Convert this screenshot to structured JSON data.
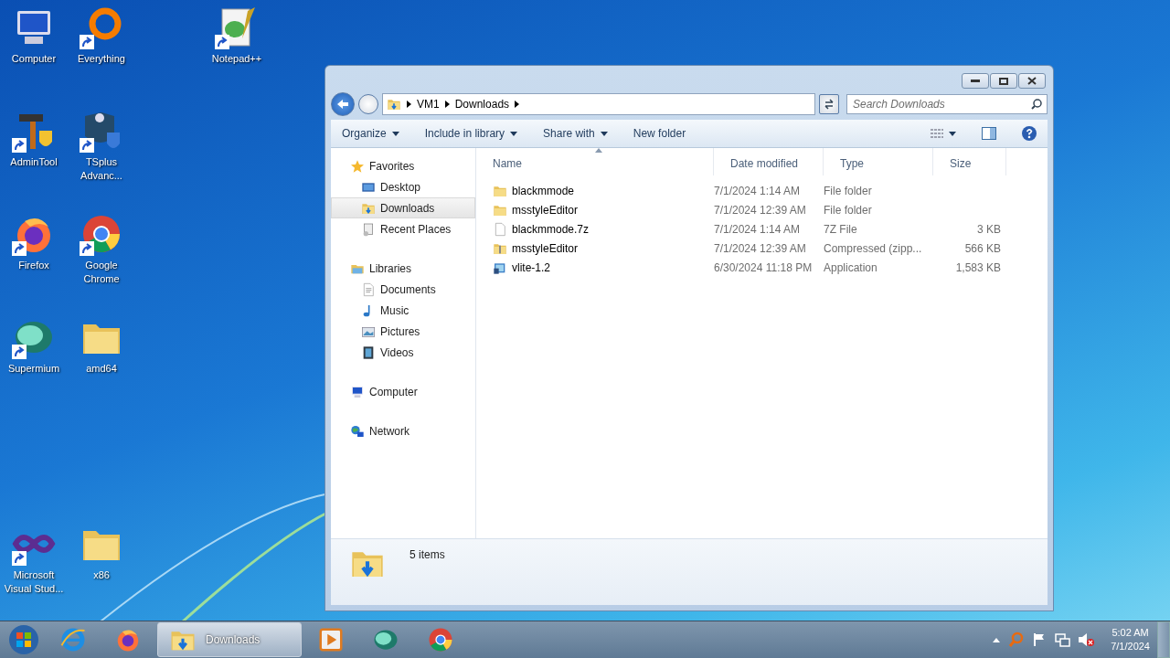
{
  "desktop_icons": [
    {
      "label": "Computer",
      "kind": "computer",
      "shortcut": false
    },
    {
      "label": "Everything",
      "kind": "ring",
      "shortcut": true
    },
    {
      "label": "Notepad++",
      "kind": "notepad",
      "shortcut": true
    },
    {
      "label": "AdminTool",
      "kind": "hammer",
      "shortcut": true
    },
    {
      "label": "TSplus Advanc...",
      "kind": "shield",
      "shortcut": true
    },
    {
      "label": "Firefox",
      "kind": "firefox",
      "shortcut": true
    },
    {
      "label": "Google Chrome",
      "kind": "chrome",
      "shortcut": true
    },
    {
      "label": "Supermium",
      "kind": "supermium",
      "shortcut": true
    },
    {
      "label": "amd64",
      "kind": "folder",
      "shortcut": false
    },
    {
      "label": "Microsoft Visual Stud...",
      "kind": "vs",
      "shortcut": true
    },
    {
      "label": "x86",
      "kind": "folder",
      "shortcut": false
    }
  ],
  "explorer": {
    "address": [
      "VM1",
      "Downloads"
    ],
    "search": {
      "placeholder": "Search Downloads"
    },
    "toolbar": [
      {
        "label": "Organize",
        "dropdown": true
      },
      {
        "label": "Include in library",
        "dropdown": true
      },
      {
        "label": "Share with",
        "dropdown": true
      },
      {
        "label": "New folder",
        "dropdown": false
      }
    ],
    "nav": [
      {
        "label": "Favorites",
        "kind": "star",
        "selected": false,
        "children": [
          {
            "label": "Desktop",
            "kind": "desktop",
            "selected": false
          },
          {
            "label": "Downloads",
            "kind": "downloads",
            "selected": true
          },
          {
            "label": "Recent Places",
            "kind": "recent",
            "selected": false
          }
        ]
      },
      {
        "label": "Libraries",
        "kind": "library",
        "selected": false,
        "children": [
          {
            "label": "Documents",
            "kind": "document",
            "selected": false
          },
          {
            "label": "Music",
            "kind": "music",
            "selected": false
          },
          {
            "label": "Pictures",
            "kind": "pictures",
            "selected": false
          },
          {
            "label": "Videos",
            "kind": "videos",
            "selected": false
          }
        ]
      },
      {
        "label": "Computer",
        "kind": "computer",
        "selected": false
      },
      {
        "label": "Network",
        "kind": "network",
        "selected": false
      }
    ],
    "columns": [
      {
        "label": "Name",
        "sorted": true
      },
      {
        "label": "Date modified",
        "sorted": false
      },
      {
        "label": "Type",
        "sorted": false
      },
      {
        "label": "Size",
        "sorted": false
      }
    ],
    "rows": [
      {
        "kind": "folder",
        "name": "blackmmode",
        "date": "7/1/2024 1:14 AM",
        "type": "File folder"
      },
      {
        "kind": "folder",
        "name": "msstyleEditor",
        "date": "7/1/2024 12:39 AM",
        "type": "File folder"
      },
      {
        "kind": "file",
        "name": "blackmmode.7z",
        "date": "7/1/2024 1:14 AM",
        "type": "7Z File",
        "size": "3 KB"
      },
      {
        "kind": "zip",
        "name": "msstyleEditor",
        "date": "7/1/2024 12:39 AM",
        "type": "Compressed (zipp...",
        "size": "566 KB"
      },
      {
        "kind": "app",
        "name": "vlite-1.2",
        "date": "6/30/2024 11:18 PM",
        "type": "Application",
        "size": "1,583 KB"
      }
    ],
    "status": "5 items"
  },
  "taskbar": {
    "items": [
      {
        "kind": "ie",
        "active": false
      },
      {
        "kind": "firefox",
        "active": false
      },
      {
        "kind": "downloads",
        "label": "Downloads",
        "active": true
      },
      {
        "kind": "media",
        "active": false
      },
      {
        "kind": "supermium",
        "active": false
      },
      {
        "kind": "chrome",
        "active": false
      }
    ],
    "time": "5:02 AM",
    "date": "7/1/2024"
  }
}
